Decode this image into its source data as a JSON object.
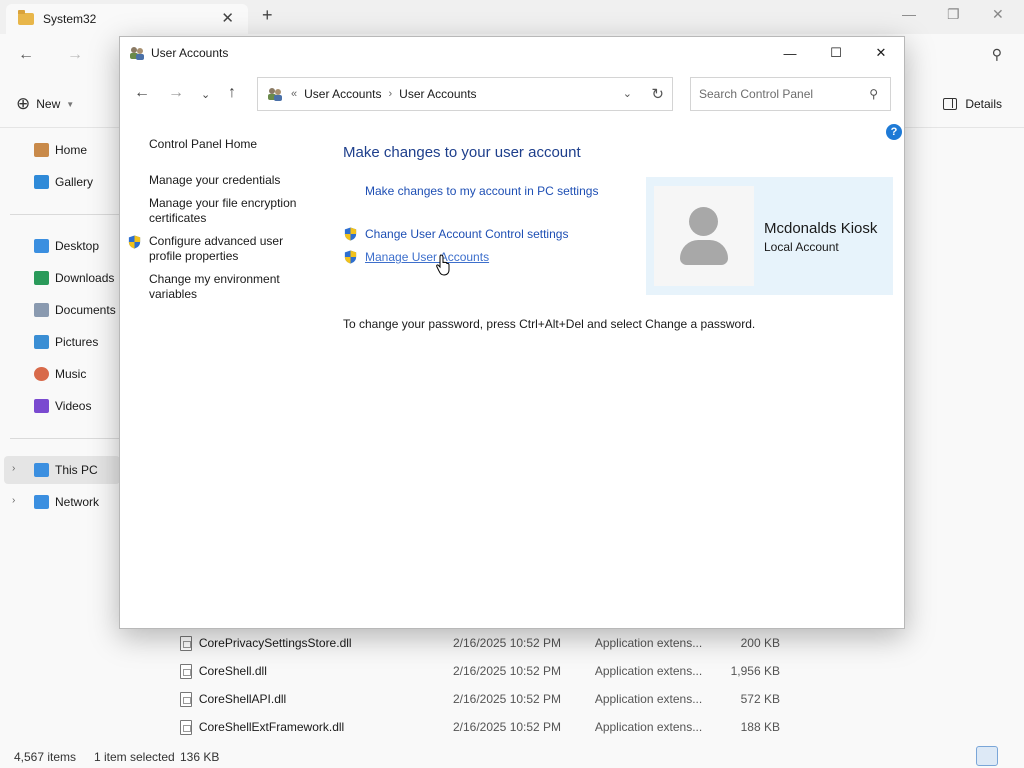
{
  "explorer": {
    "tab_title": "System32",
    "toolbar": {
      "new_label": "New",
      "details_label": "Details"
    },
    "sidebar": {
      "quick": [
        {
          "label": "Home",
          "icon": "home-icon",
          "color": "#c98a4a"
        },
        {
          "label": "Gallery",
          "icon": "gallery-icon",
          "color": "#2f8ad8"
        }
      ],
      "folders": [
        {
          "label": "Desktop",
          "icon": "desktop-icon",
          "color": "#3b8fe0"
        },
        {
          "label": "Downloads",
          "icon": "downloads-icon",
          "color": "#2a9a5a"
        },
        {
          "label": "Documents",
          "icon": "documents-icon",
          "color": "#8a9ab0"
        },
        {
          "label": "Pictures",
          "icon": "pictures-icon",
          "color": "#3a8ed4"
        },
        {
          "label": "Music",
          "icon": "music-icon",
          "color": "#d86a4a"
        },
        {
          "label": "Videos",
          "icon": "videos-icon",
          "color": "#7a4ad0"
        }
      ],
      "devices": [
        {
          "label": "This PC",
          "icon": "this-pc-icon",
          "color": "#3b8fe0"
        },
        {
          "label": "Network",
          "icon": "network-icon",
          "color": "#3b8fe0"
        }
      ]
    },
    "files": [
      {
        "name": "CorePrivacySettingsStore.dll",
        "date": "2/16/2025 10:52 PM",
        "type": "Application extens...",
        "size": "200 KB"
      },
      {
        "name": "CoreShell.dll",
        "date": "2/16/2025 10:52 PM",
        "type": "Application extens...",
        "size": "1,956 KB"
      },
      {
        "name": "CoreShellAPI.dll",
        "date": "2/16/2025 10:52 PM",
        "type": "Application extens...",
        "size": "572 KB"
      },
      {
        "name": "CoreShellExtFramework.dll",
        "date": "2/16/2025 10:52 PM",
        "type": "Application extens...",
        "size": "188 KB"
      }
    ],
    "status": {
      "items": "4,567 items",
      "selected": "1 item selected",
      "size": "136 KB"
    }
  },
  "dialog": {
    "title": "User Accounts",
    "breadcrumb": {
      "prefix": "«",
      "items": [
        "User Accounts",
        "User Accounts"
      ]
    },
    "search_placeholder": "Search Control Panel",
    "help_label": "?",
    "left_links": [
      {
        "label": "Control Panel Home",
        "shield": false
      },
      {
        "label": "Manage your credentials",
        "shield": false
      },
      {
        "label": "Manage your file encryption certificates",
        "shield": false
      },
      {
        "label": "Configure advanced user profile properties",
        "shield": true
      },
      {
        "label": "Change my environment variables",
        "shield": false
      }
    ],
    "heading": "Make changes to your user account",
    "links": [
      {
        "label": "Make changes to my account in PC settings",
        "shield": false
      },
      {
        "label": "Change User Account Control settings",
        "shield": true
      },
      {
        "label": "Manage User Accounts",
        "shield": true
      }
    ],
    "note": "To change your password, press Ctrl+Alt+Del and select Change a password.",
    "account": {
      "name": "Mcdonalds Kiosk",
      "type": "Local Account"
    }
  },
  "colors": {
    "link": "#1e4fb4",
    "heading": "#1e3f8c",
    "accent": "#1e7ad6",
    "account_bg": "#e7f3fb"
  }
}
